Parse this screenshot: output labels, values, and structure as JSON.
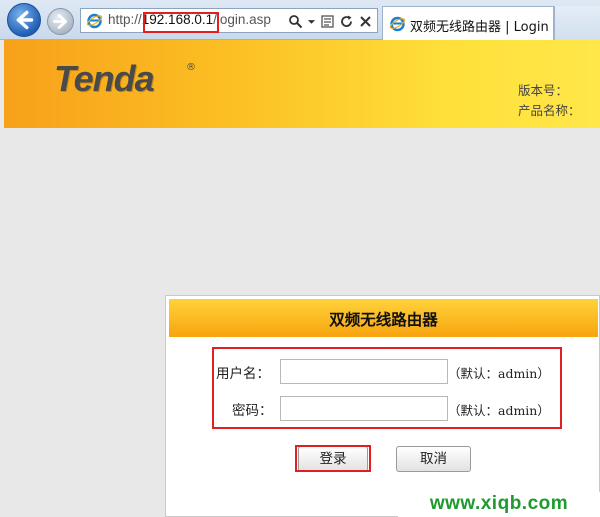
{
  "browser": {
    "url_prefix": "http://",
    "url_host": "192.168.0.1",
    "url_path": "/login.asp",
    "tab_title": "双频无线路由器 | Login",
    "icons": [
      "back-arrow-icon",
      "forward-arrow-icon",
      "ie-logo-icon",
      "search-icon",
      "dropdown-icon",
      "compat-view-icon",
      "refresh-icon",
      "stop-icon"
    ]
  },
  "header": {
    "logo_text": "Tenda",
    "logo_mark": "®",
    "version_label": "版本号：",
    "product_label": "产品名称："
  },
  "login": {
    "title": "双频无线路由器",
    "username_label": "用户名：",
    "username_value": "",
    "username_hint": "（默认：admin）",
    "password_label": "密码：",
    "password_value": "",
    "password_hint": "（默认：admin）",
    "login_button": "登录",
    "cancel_button": "取消"
  },
  "watermark": "www.xiqb.com",
  "colors": {
    "banner_start": "#f7a11a",
    "banner_end": "#ffe74a",
    "highlight": "#e02020",
    "watermark": "#1f9a2e"
  }
}
